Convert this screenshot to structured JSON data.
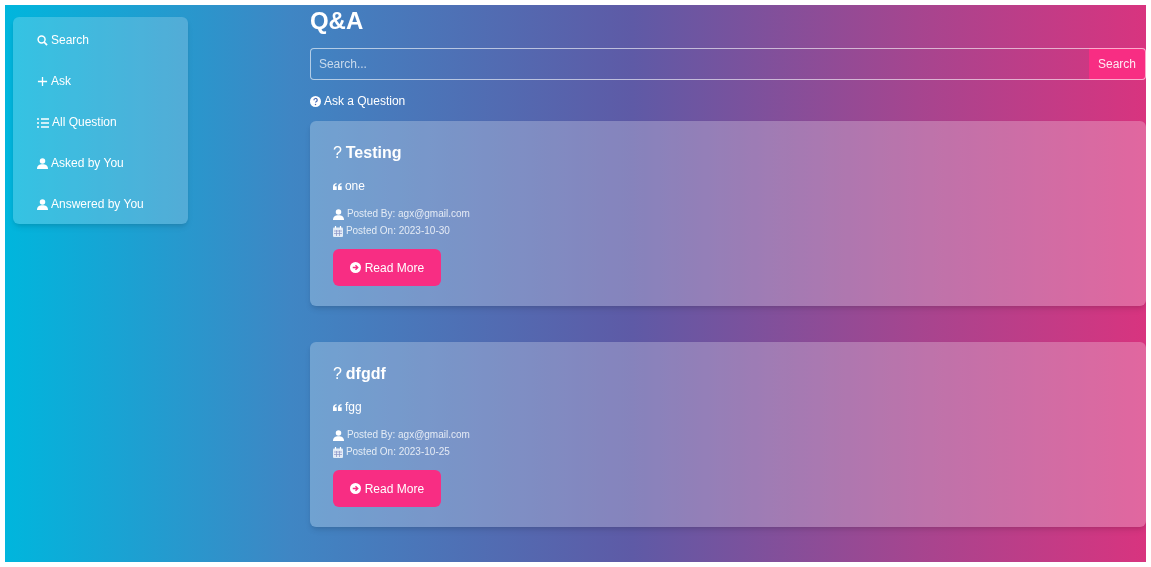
{
  "sidebar": {
    "items": [
      {
        "kind": "search",
        "label": "Search"
      },
      {
        "kind": "plus",
        "label": "Ask"
      },
      {
        "kind": "list",
        "label": "All Question"
      },
      {
        "kind": "user",
        "label": "Asked by You"
      },
      {
        "kind": "user",
        "label": "Answered by You"
      }
    ]
  },
  "title": "Q&A",
  "search": {
    "placeholder": "Search...",
    "button": "Search"
  },
  "ask_link": "Ask a Question",
  "questions": [
    {
      "mark": "?",
      "title": "Testing",
      "body": "one",
      "posted_by": "Posted By: agx@gmail.com",
      "posted_on": "Posted On: 2023-10-30",
      "button": "Read More"
    },
    {
      "mark": "?",
      "title": "dfgdf",
      "body": "fgg",
      "posted_by": "Posted By: agx@gmail.com",
      "posted_on": "Posted On: 2023-10-25",
      "button": "Read More"
    }
  ]
}
